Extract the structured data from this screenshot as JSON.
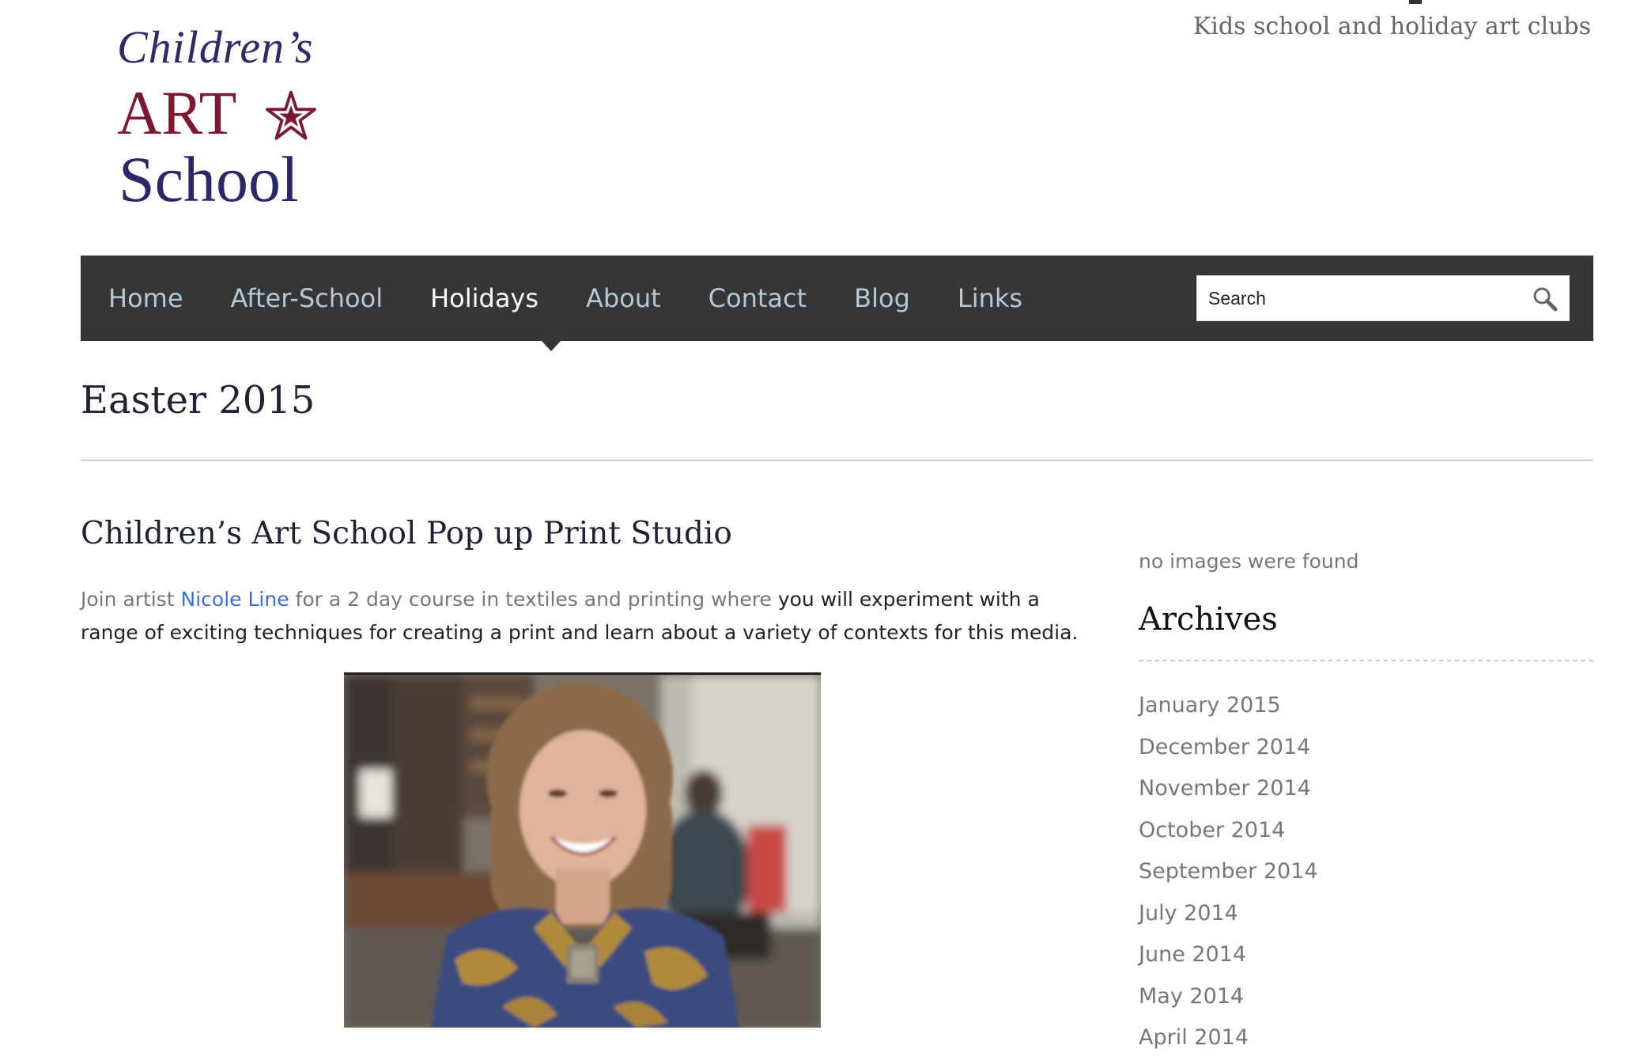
{
  "site": {
    "logo": {
      "line1": "Children’s",
      "line2": "ART",
      "line3": "School"
    },
    "tagline": "Kids school and holiday art clubs"
  },
  "nav": {
    "items": [
      {
        "label": "Home"
      },
      {
        "label": "After-School"
      },
      {
        "label": "Holidays",
        "active": true
      },
      {
        "label": "About"
      },
      {
        "label": "Contact"
      },
      {
        "label": "Blog"
      },
      {
        "label": "Links"
      }
    ],
    "search": {
      "placeholder": "Search",
      "icon": "search-icon"
    }
  },
  "page": {
    "title": "Easter 2015"
  },
  "post": {
    "title": "Children’s Art School Pop up Print Studio",
    "text": {
      "part1": "Join artist ",
      "link": "Nicole Line",
      "part2": " for a 2 day course in textiles and printing where ",
      "part3": "you will experiment with a range of exciting techniques for creating a print and learn about a variety of contexts for this media."
    }
  },
  "sidebar": {
    "no_images_text": "no images were found",
    "archives": {
      "heading": "Archives",
      "items": [
        "January 2015",
        "December 2014",
        "November 2014",
        "October 2014",
        "September 2014",
        "July 2014",
        "June 2014",
        "May 2014",
        "April 2014"
      ]
    }
  },
  "colors": {
    "nav_background": "#363636",
    "nav_text": "#b4c8d6",
    "nav_active_text": "#ffffff",
    "link": "#3a6fd8",
    "logo_blue": "#2e2b6b",
    "logo_red": "#7d1830"
  }
}
